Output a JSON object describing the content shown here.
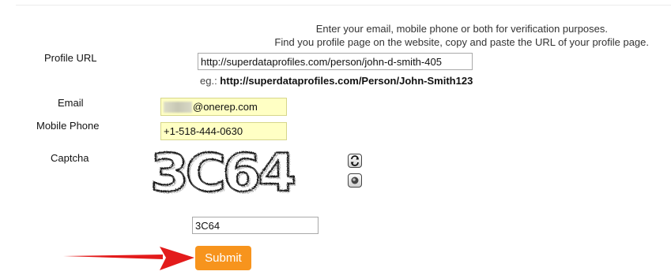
{
  "intro": {
    "line1": "Enter your email, mobile phone or both for verification purposes.",
    "line2": "Find you profile page on the website, copy and paste the URL of your profile page."
  },
  "form": {
    "profile_url": {
      "label": "Profile URL",
      "value": "http://superdataprofiles.com/person/john-d-smith-405",
      "example_prefix": "eg.: ",
      "example_url": "http://superdataprofiles.com/Person/John-Smith123"
    },
    "email": {
      "label": "Email",
      "value": "@onerep.com"
    },
    "mobile_phone": {
      "label": "Mobile Phone",
      "value": "+1-518-444-0630"
    },
    "captcha": {
      "label": "Captcha",
      "image_text": "3C64",
      "input_value": "3C64",
      "refresh_icon": "refresh-icon",
      "audio_icon": "audio-icon"
    },
    "submit_label": "Submit"
  },
  "colors": {
    "submit_bg": "#f7941d",
    "autofill_bg": "#ffffc4",
    "annotation_arrow": "#e31b1b"
  }
}
